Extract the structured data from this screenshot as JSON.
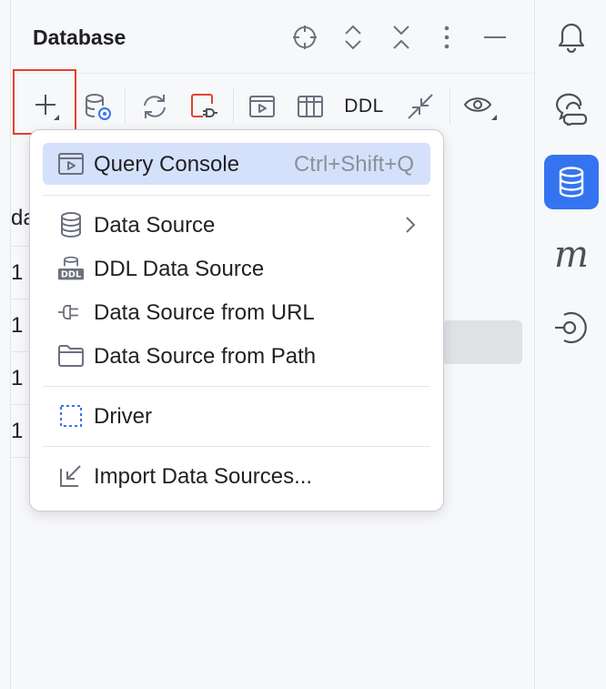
{
  "panel": {
    "title": "Database",
    "header_icons": [
      "crosshair-icon",
      "expand-all-icon",
      "collapse-all-icon",
      "more-icon",
      "minimize-icon"
    ]
  },
  "toolbar": {
    "ddl_label": "DDL",
    "buttons": [
      "add-icon",
      "data-source-properties-icon",
      "refresh-icon",
      "disconnect-icon",
      "query-console-icon",
      "table-icon",
      "ddl",
      "jump-icon",
      "view-options-icon"
    ]
  },
  "background_rows": [
    "da",
    "1",
    "1",
    "1",
    "1"
  ],
  "menu": {
    "query_console": {
      "label": "Query Console",
      "shortcut": "Ctrl+Shift+Q"
    },
    "data_source": {
      "label": "Data Source"
    },
    "ddl_data_source": {
      "label": "DDL Data Source",
      "icon_text": "DDL"
    },
    "data_source_url": {
      "label": "Data Source from URL"
    },
    "data_source_path": {
      "label": "Data Source from Path"
    },
    "driver": {
      "label": "Driver"
    },
    "import": {
      "label": "Import Data Sources..."
    }
  },
  "right_strip": {
    "icons": [
      "notifications-icon",
      "ai-chat-icon",
      "database-icon",
      "maven-icon",
      "endpoints-icon"
    ],
    "maven_glyph": "m",
    "active": "database-icon"
  },
  "colors": {
    "accent": "#3574f0",
    "selection": "#d5e1fb",
    "highlight_border": "#e5412d",
    "driver_icon": "#3574f0"
  }
}
